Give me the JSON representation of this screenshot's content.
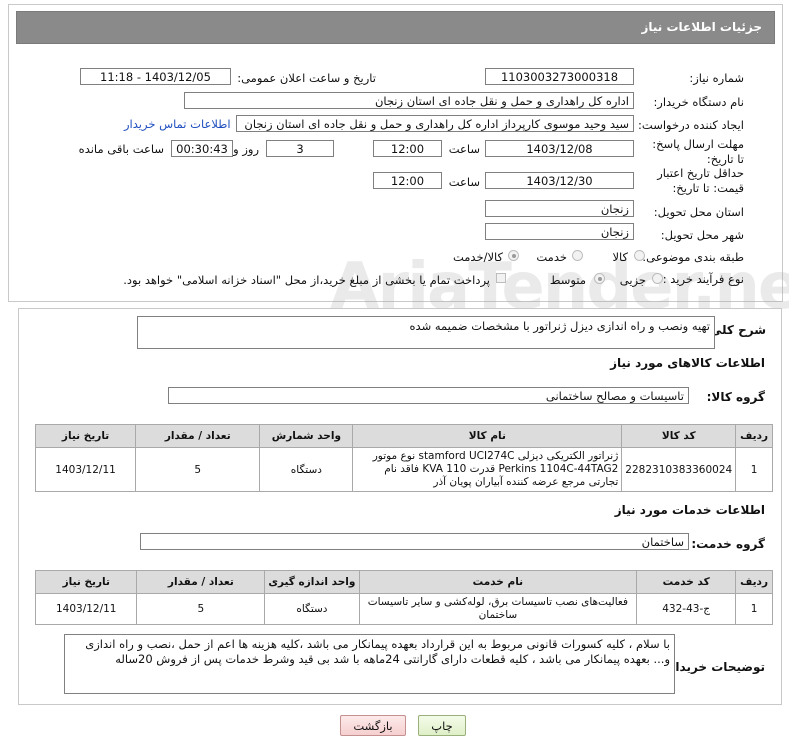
{
  "header": {
    "title": "جزئیات اطلاعات نیاز"
  },
  "fields": {
    "need_number_label": "شماره نیاز:",
    "need_number": "1103003273000318",
    "announce_label": "تاریخ و ساعت اعلان عمومی:",
    "announce_value": "1403/12/05 - 11:18",
    "buyer_label": "نام دستگاه خریدار:",
    "buyer_value": "اداره کل راهداری و حمل و نقل جاده ای استان زنجان",
    "creator_label": "ایجاد کننده درخواست:",
    "creator_value": "سید وحید موسوی کارپرداز اداره کل راهداری و حمل و نقل جاده ای استان زنجان",
    "contact_link": "اطلاعات تماس خریدار",
    "deadline_label": "مهلت ارسال پاسخ: تا تاریخ:",
    "deadline_date": "1403/12/08",
    "time_label": "ساعت",
    "deadline_time": "12:00",
    "days_value": "3",
    "days_label": "روز و",
    "remaining_time": "00:30:43",
    "remaining_label": "ساعت باقی مانده",
    "validity_label": "حداقل تاریخ اعتبار قیمت: تا تاریخ:",
    "validity_date": "1403/12/30",
    "validity_time": "12:00",
    "province_label": "استان محل تحویل:",
    "province_value": "زنجان",
    "city_label": "شهر محل تحویل:",
    "city_value": "زنجان",
    "category_label": "طبقه بندی موضوعی:",
    "category_options": [
      "کالا",
      "خدمت",
      "کالا/خدمت"
    ],
    "category_selected": "کالا/خدمت",
    "process_label": "نوع فرآیند خرید :",
    "process_options": [
      "جزیی",
      "متوسط"
    ],
    "process_selected": "متوسط",
    "payment_note": "پرداخت تمام یا بخشی از مبلغ خرید،از محل \"اسناد خزانه اسلامی\" خواهد بود."
  },
  "summary": {
    "label": "شرح کلی نیاز:",
    "value": "تهیه ونصب و راه اندازی دیزل ژنراتور با مشخصات ضمیمه شده"
  },
  "goods": {
    "section_title": "اطلاعات کالاهای مورد نیاز",
    "group_label": "گروه کالا:",
    "group_value": "تاسیسات و مصالح ساختمانی",
    "headers": [
      "ردیف",
      "کد کالا",
      "نام کالا",
      "واحد شمارش",
      "تعداد / مقدار",
      "تاریخ نیاز"
    ],
    "rows": [
      {
        "row": "1",
        "code": "2282310383360024",
        "name": "ژنراتور الکتریکی دیزلی stamford UCI274C نوع موتور Perkins 1104C-44TAG2 قدرت KVA 110 فاقد نام تجارتی مرجع عرضه کننده آبیاران پویان آذر",
        "unit": "دستگاه",
        "qty": "5",
        "date": "1403/12/11"
      }
    ]
  },
  "services": {
    "section_title": "اطلاعات خدمات مورد نیاز",
    "group_label": "گروه خدمت:",
    "group_value": "ساختمان",
    "headers": [
      "ردیف",
      "کد خدمت",
      "نام خدمت",
      "واحد اندازه گیری",
      "تعداد / مقدار",
      "تاریخ نیاز"
    ],
    "rows": [
      {
        "row": "1",
        "code": "ج-43-432",
        "name": "فعالیت‌های نصب تاسیسات برق، لوله‌کشی و سایر تاسیسات ساختمان",
        "unit": "دستگاه",
        "qty": "5",
        "date": "1403/12/11"
      }
    ]
  },
  "buyer_notes": {
    "label": "توضیحات خریدار:",
    "line1": "با سلام ، کلیه کسورات قانونی مربوط به این قرارداد بعهده پیمانکار می باشد ،کلیه هزینه ها اعم از حمل ،نصب و راه اندازی",
    "line2": "و... بعهده پیمانکار می باشد ، کلیه قطعات دارای گارانتی 24ماهه با شد بی قید وشرط خدمات پس از فروش 20ساله"
  },
  "buttons": {
    "print": "چاپ",
    "back": "بازگشت"
  },
  "watermark": "AriaTender.neT"
}
